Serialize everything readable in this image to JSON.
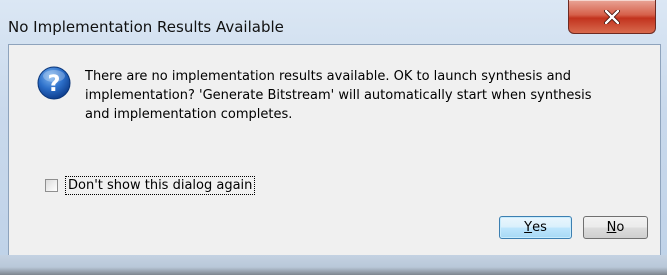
{
  "dialog": {
    "title": "No Implementation Results Available",
    "close_icon": "close-icon",
    "question_icon": "question-icon",
    "message_lines": [
      "There are no implementation results available. OK to launch synthesis and",
      "implementation? 'Generate Bitstream' will automatically start when synthesis",
      "and implementation completes."
    ],
    "checkbox": {
      "label": "Don't show this dialog again",
      "checked": false
    },
    "buttons": {
      "yes_mnemonic": "Y",
      "yes_rest": "es",
      "no_mnemonic": "N",
      "no_rest": "o"
    }
  },
  "colors": {
    "title_bar": "#c9d9ec",
    "close_button": "#c2331e",
    "client_background": "#f0f0f0",
    "default_button_border": "#3c7fb1"
  }
}
